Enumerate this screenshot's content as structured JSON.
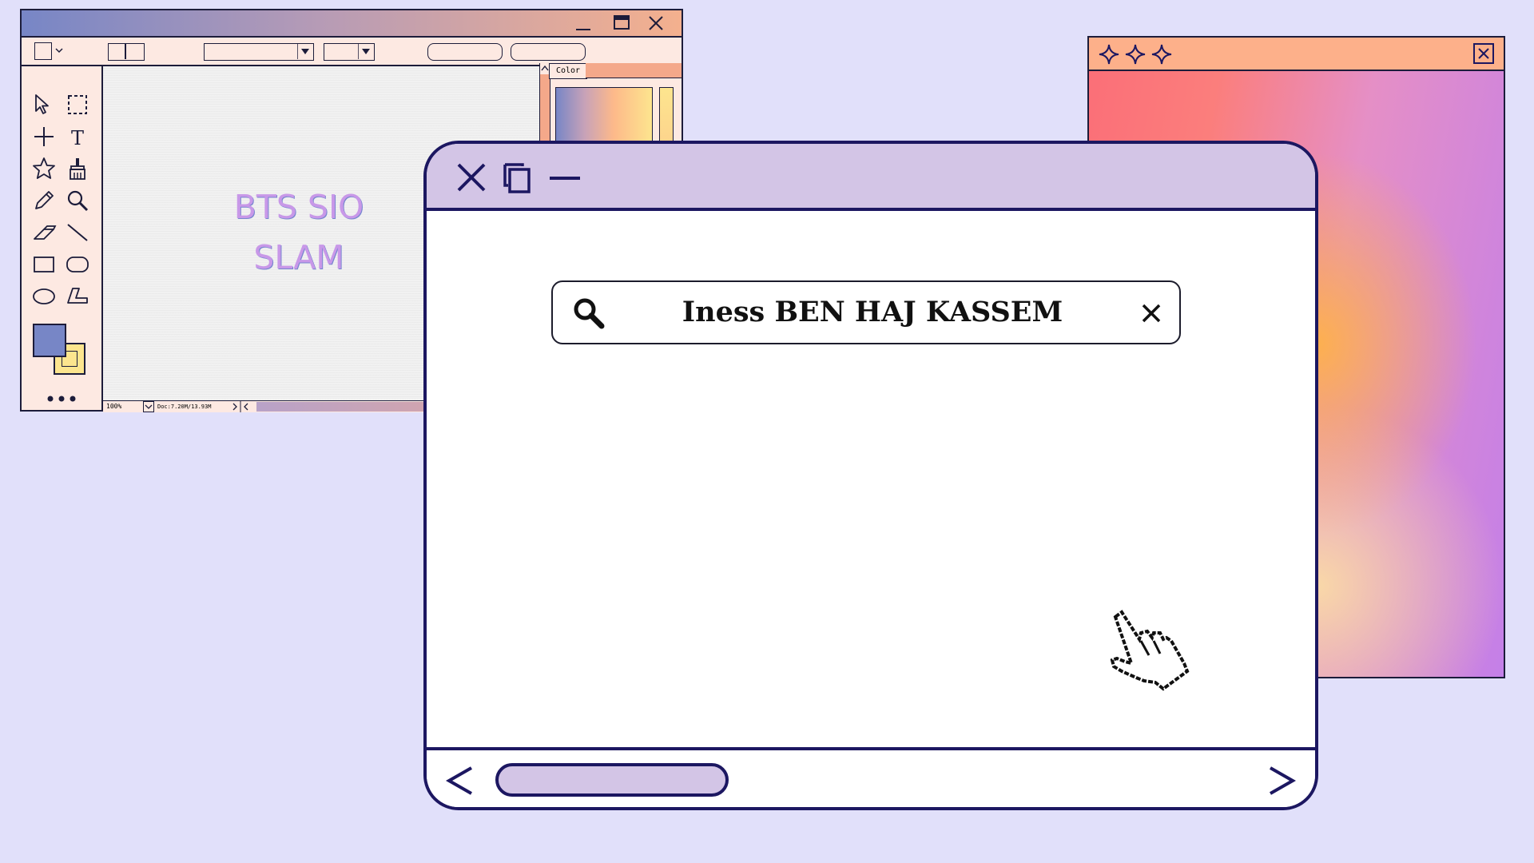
{
  "paint_window": {
    "canvas_text_line1": "BTS SIO",
    "canvas_text_line2": "SLAM",
    "color_panel_label": "Color",
    "status_zoom": "100%",
    "status_doc": "Doc:7.20M/13.93M"
  },
  "browser": {
    "search_query": "Iness BEN HAJ KASSEM"
  },
  "colors": {
    "background": "#e1e0fa",
    "browser_chrome": "#d3c5e6",
    "outline": "#1c1761",
    "foreground_color_swatch": "#7786c6",
    "background_color_swatch": "#fde58e"
  }
}
